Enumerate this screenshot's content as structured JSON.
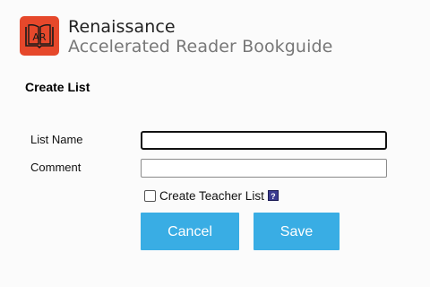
{
  "header": {
    "brand": "Renaissance",
    "product": "Accelerated Reader Bookguide",
    "logo_icon": "ar-book-logo-icon",
    "logo_color": "#e6482b"
  },
  "form": {
    "title": "Create List",
    "list_name_label": "List Name",
    "list_name_value": "",
    "comment_label": "Comment",
    "comment_value": "",
    "teacher_list_label": "Create Teacher List",
    "teacher_list_checked": false,
    "help_icon": "?"
  },
  "buttons": {
    "cancel_label": "Cancel",
    "save_label": "Save",
    "color": "#39ade4"
  }
}
